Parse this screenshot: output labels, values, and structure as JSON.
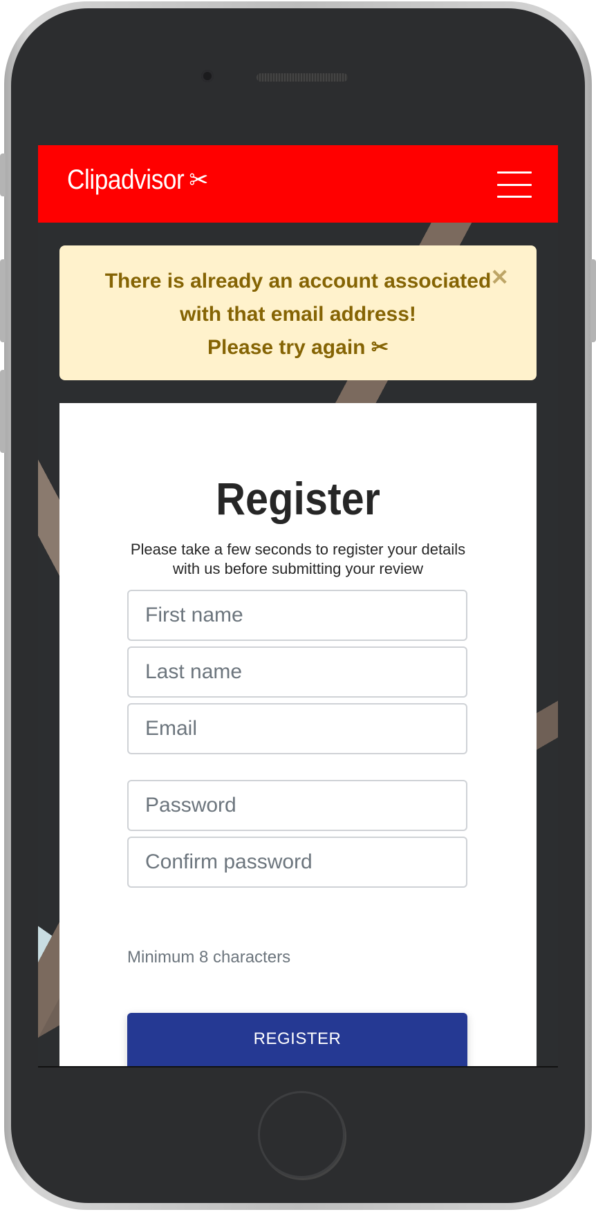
{
  "navbar": {
    "brand": "Clipadvisor",
    "brand_icon": "✂",
    "menu_icon": "hamburger-icon"
  },
  "alert": {
    "line1": "There is already an account associated",
    "line2": "with that email address!",
    "line3": "Please try again",
    "line3_icon": "✂",
    "close_icon": "✕",
    "bg_color": "#fff2cc",
    "text_color": "#856404"
  },
  "form": {
    "title": "Register",
    "subtitle": "Please take a few seconds to register your details with us before submitting your review",
    "first_name_placeholder": "First name",
    "last_name_placeholder": "Last name",
    "email_placeholder": "Email",
    "password_placeholder": "Password",
    "confirm_password_placeholder": "Confirm password",
    "password_hint": "Minimum 8 characters",
    "submit_label": "REGISTER"
  },
  "colors": {
    "navbar": "#ff0000",
    "button": "#253993"
  }
}
